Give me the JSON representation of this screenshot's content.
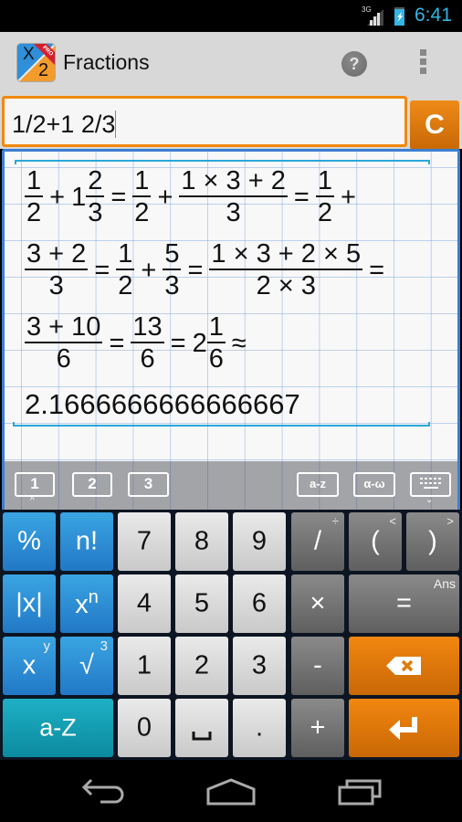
{
  "status_bar": {
    "network": "3G",
    "time": "6:41",
    "icons": [
      "signal-icon",
      "battery-charging-icon"
    ]
  },
  "action_bar": {
    "app_icon": {
      "top": "X",
      "bottom": "2",
      "badge": "PRO"
    },
    "title": "Fractions",
    "help_icon": "?",
    "overflow_icon": "more-vertical-icon"
  },
  "input": {
    "expression": "1/2+1 2/3",
    "clear_label": "C"
  },
  "result": {
    "line1": [
      {
        "t": "frac",
        "n": "1",
        "d": "2"
      },
      {
        "t": "op",
        "v": "+"
      },
      {
        "t": "mixed",
        "w": "1",
        "n": "2",
        "d": "3"
      },
      {
        "t": "op",
        "v": "="
      },
      {
        "t": "frac",
        "n": "1",
        "d": "2"
      },
      {
        "t": "op",
        "v": "+"
      },
      {
        "t": "frac",
        "n": "1 × 3 + 2",
        "d": "3"
      },
      {
        "t": "op",
        "v": "="
      },
      {
        "t": "frac",
        "n": "1",
        "d": "2"
      },
      {
        "t": "op",
        "v": "+"
      }
    ],
    "line2": [
      {
        "t": "frac",
        "n": "3 + 2",
        "d": "3"
      },
      {
        "t": "op",
        "v": "="
      },
      {
        "t": "frac",
        "n": "1",
        "d": "2"
      },
      {
        "t": "op",
        "v": "+"
      },
      {
        "t": "frac",
        "n": "5",
        "d": "3"
      },
      {
        "t": "op",
        "v": "="
      },
      {
        "t": "frac",
        "n": "1 × 3 + 2 × 5",
        "d": "2 × 3"
      },
      {
        "t": "op",
        "v": "="
      }
    ],
    "line3": [
      {
        "t": "frac",
        "n": "3 + 10",
        "d": "6"
      },
      {
        "t": "op",
        "v": "="
      },
      {
        "t": "frac",
        "n": "13",
        "d": "6"
      },
      {
        "t": "op",
        "v": "="
      },
      {
        "t": "mixed",
        "w": "2",
        "n": "1",
        "d": "6"
      },
      {
        "t": "op",
        "v": "≈"
      }
    ],
    "decimal": "2.1666666666666667"
  },
  "keyboard_tabs": {
    "tab1": "1",
    "tab2": "2",
    "tab3": "3",
    "latin": "a-z",
    "greek": "α-ω",
    "keyboard_icon": "keyboard-icon",
    "up_chevron": "^",
    "down_chevron": "⌄"
  },
  "keys": {
    "percent": "%",
    "factorial": "n!",
    "seven": "7",
    "eight": "8",
    "nine": "9",
    "divide": "/",
    "divide_alt": "÷",
    "open_paren": "(",
    "open_paren_alt": "<",
    "close_paren": ")",
    "close_paren_alt": ">",
    "abs": "|x|",
    "power_base": "x",
    "power_exp": "n",
    "four": "4",
    "five": "5",
    "six": "6",
    "multiply": "×",
    "equals": "=",
    "equals_alt": "Ans",
    "x_label": "x",
    "x_alt": "y",
    "sqrt": "√",
    "sqrt_alt": "3",
    "one": "1",
    "two": "2",
    "three": "3",
    "minus": "-",
    "backspace": "backspace-icon",
    "alpha": "a-Z",
    "zero": "0",
    "space": "␣",
    "dot": ".",
    "plus": "+",
    "enter": "enter-icon"
  },
  "nav_bar": {
    "back": "back-icon",
    "home": "home-icon",
    "recents": "recents-icon"
  }
}
